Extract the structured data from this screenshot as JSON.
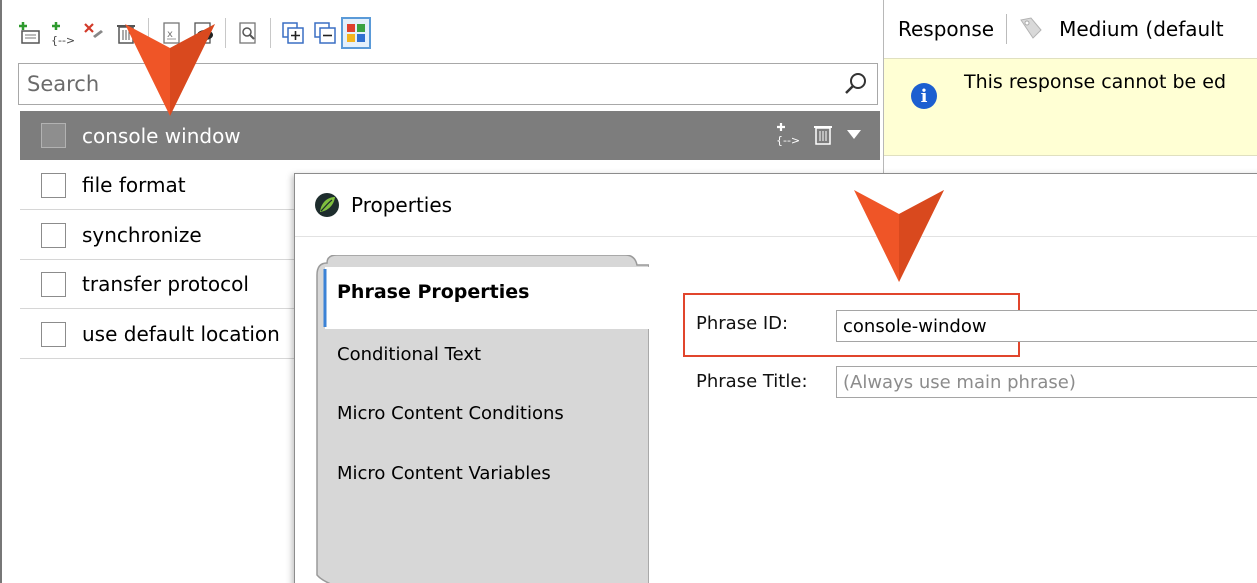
{
  "toolbar": {
    "buttons": [
      {
        "icon": "add-phrase-icon",
        "label": "Add phrase"
      },
      {
        "icon": "add-phrase-variant-icon",
        "label": "Add phrase variant"
      },
      {
        "icon": "delete-phrase-icon",
        "label": "Delete phrase"
      },
      {
        "icon": "trash-icon",
        "label": "Delete"
      },
      {
        "icon": "export-icon",
        "label": "Export"
      },
      {
        "icon": "preview-icon",
        "label": "Preview"
      },
      {
        "icon": "find-icon",
        "label": "Find"
      },
      {
        "icon": "expand-all-icon",
        "label": "Expand all"
      },
      {
        "icon": "collapse-all-icon",
        "label": "Collapse all"
      },
      {
        "icon": "grid-view-icon",
        "label": "Grid view"
      }
    ]
  },
  "search": {
    "placeholder": "Search"
  },
  "phrases": [
    {
      "label": "console window",
      "selected": true
    },
    {
      "label": "file format",
      "selected": false
    },
    {
      "label": "synchronize",
      "selected": false
    },
    {
      "label": "transfer protocol",
      "selected": false
    },
    {
      "label": "use default location",
      "selected": false
    }
  ],
  "response_panel": {
    "title": "Response",
    "medium": "Medium (default",
    "info_message": "This response cannot be ed"
  },
  "dialog": {
    "title": "Properties",
    "tabs": [
      {
        "label": "Phrase Properties",
        "active": true
      },
      {
        "label": "Conditional Text",
        "active": false
      },
      {
        "label": "Micro Content Conditions",
        "active": false
      },
      {
        "label": "Micro Content Variables",
        "active": false
      }
    ],
    "phrase_id_label": "Phrase ID:",
    "phrase_id_value": "console-window",
    "phrase_title_label": "Phrase Title:",
    "phrase_title_placeholder": "(Always use main phrase)"
  },
  "colors": {
    "callout": "#ef5527",
    "highlight": "#e1452c",
    "selected_row": "#7d7d7d",
    "info_bar": "#ffffd4",
    "info_icon": "#1c5fd0"
  }
}
